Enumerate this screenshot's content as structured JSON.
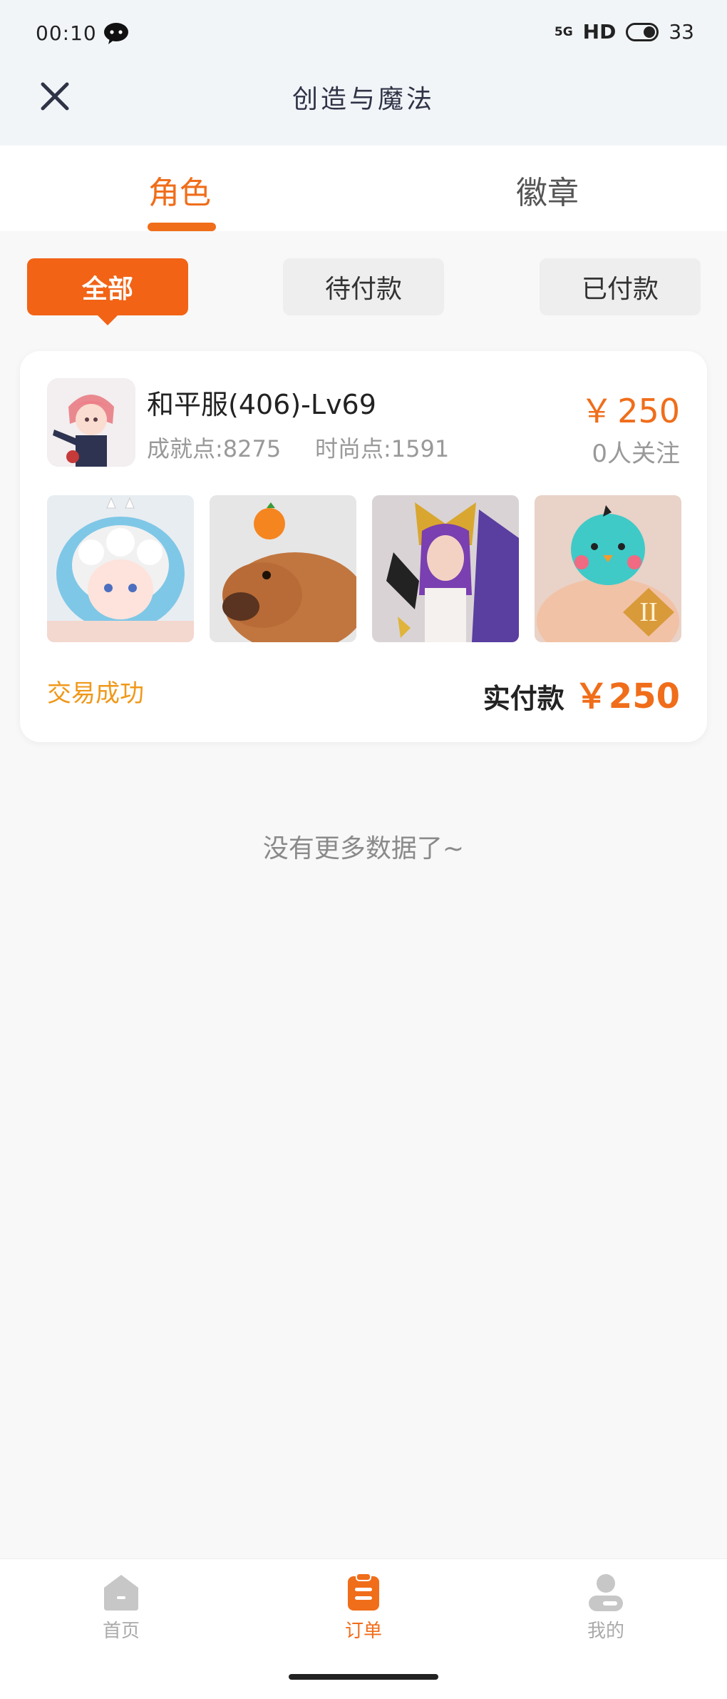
{
  "status_bar": {
    "time": "00:10",
    "network": "5G",
    "hd": "HD",
    "battery": "33",
    "icons": [
      "chat-icon",
      "signal-icon",
      "battery-toggle-icon"
    ]
  },
  "header": {
    "title": "创造与魔法",
    "close_icon": "close-icon"
  },
  "tabs": [
    {
      "label": "角色",
      "active": true
    },
    {
      "label": "徽章",
      "active": false
    }
  ],
  "filters": [
    {
      "label": "全部",
      "active": true
    },
    {
      "label": "待付款",
      "active": false
    },
    {
      "label": "已付款",
      "active": false
    }
  ],
  "order": {
    "server": "和平服(406)-Lv69",
    "achievement": "成就点:8275",
    "fashion": "时尚点:1591",
    "price_symbol": "￥",
    "price": "250",
    "followers": "0人关注",
    "thumbnails": [
      "character-avatar-1",
      "capybara-pet",
      "pharaoh-character",
      "bird-head-character"
    ],
    "status": "交易成功",
    "paid_label": "实付款",
    "paid_price": "￥250"
  },
  "no_more": "没有更多数据了~",
  "bottom_nav": [
    {
      "label": "首页",
      "icon": "home-icon",
      "active": false
    },
    {
      "label": "订单",
      "icon": "order-icon",
      "active": true
    },
    {
      "label": "我的",
      "icon": "profile-icon",
      "active": false
    }
  ],
  "colors": {
    "accent": "#f06d1a",
    "success": "#f0981a",
    "pill_inactive": "#eeeeee",
    "nav_inactive": "#c7c7c7"
  }
}
